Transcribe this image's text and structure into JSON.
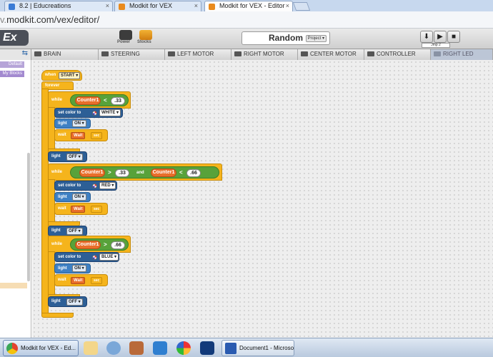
{
  "browser": {
    "tabs": [
      {
        "label": "8.2 | Educreations",
        "close": "×"
      },
      {
        "label": "Modkit for VEX",
        "close": "×"
      },
      {
        "label": "Modkit for VEX - Editor",
        "close": "×"
      }
    ],
    "url_prefix": "v.",
    "url": "modkit.com/vex/editor/"
  },
  "header": {
    "logo": "Ex",
    "icons": [
      {
        "label": "Power"
      },
      {
        "label": "Stocks"
      }
    ],
    "project_name": "Random",
    "project_button": "Project ▾",
    "run_buttons": [
      "⬇",
      "▶",
      "■"
    ],
    "jumper_select": "Jmp 2"
  },
  "device_tabs": [
    "BRAIN",
    "STEERING",
    "LEFT MOTOR",
    "RIGHT MOTOR",
    "CENTER MOTOR",
    "CONTROLLER",
    "RIGHT LED"
  ],
  "left_panel": {
    "items": [
      "Default",
      "My Blocks"
    ]
  },
  "program": {
    "when_label": "when",
    "start": "START ▾",
    "forever": "forever",
    "while_label": "while",
    "and_label": "and",
    "set_color_label": "set color to",
    "light_label": "light",
    "wait_label": "wait",
    "wait_value": "Wait",
    "sec_label": "sec",
    "counter": "Counter1",
    "lt": "<",
    "gt": ">",
    "v1": ".33",
    "v2": ".66",
    "colors": [
      "WHITE ▾",
      "RED ▾",
      "BLUE ▾"
    ],
    "on": "ON ▾",
    "off": "OFF ▾"
  },
  "taskbar": {
    "items": [
      {
        "label": "Modkit for VEX - Ed..."
      },
      {
        "label": "Document1 - Microsof..."
      }
    ]
  },
  "colors": {
    "control": "#f5b41c",
    "light_block": "#2d5f96",
    "condition": "#58a23a",
    "variable": "#e96e2a"
  }
}
